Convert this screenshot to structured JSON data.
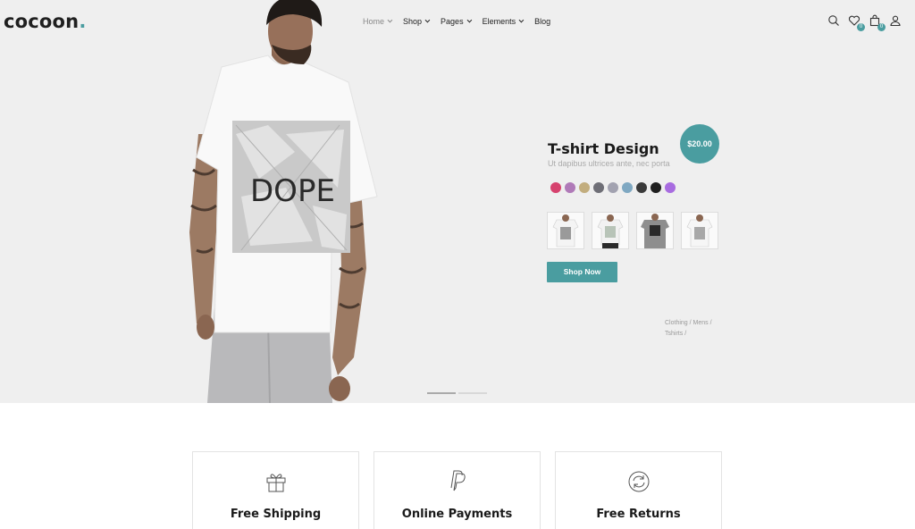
{
  "brand": {
    "logo_text": "cocoon",
    "logo_dot": ".",
    "accent": "#4a9da0"
  },
  "nav": {
    "items": [
      {
        "label": "Home",
        "has_dropdown": true
      },
      {
        "label": "Shop",
        "has_dropdown": true
      },
      {
        "label": "Pages",
        "has_dropdown": true
      },
      {
        "label": "Elements",
        "has_dropdown": true
      },
      {
        "label": "Blog",
        "has_dropdown": false
      }
    ]
  },
  "header_icons": {
    "search": {
      "icon": "search-icon"
    },
    "wishlist": {
      "icon": "heart-icon",
      "count": "0"
    },
    "cart": {
      "icon": "bag-icon",
      "count": "0"
    },
    "account": {
      "icon": "user-icon"
    }
  },
  "hero": {
    "model_shirt_text": "DOPE",
    "product": {
      "title": "T-shirt Design",
      "subtitle": "Ut dapibus ultrices ante, nec porta",
      "price": "$20.00",
      "colors": [
        "#d6426e",
        "#b07ab8",
        "#c2ad7e",
        "#6e6e76",
        "#a2a2b0",
        "#7fa8c2",
        "#3a3a3a",
        "#1f1f1f",
        "#a86ce0"
      ],
      "cta": "Shop Now",
      "breadcrumb": {
        "cat1": "Clothing",
        "cat2": "Mens",
        "cat3": "Tshirts",
        "sep": "/"
      }
    },
    "slides": {
      "count": 2,
      "active": 1
    }
  },
  "features": [
    {
      "title": "Free Shipping",
      "icon": "gift-icon"
    },
    {
      "title": "Online Payments",
      "icon": "paypal-icon"
    },
    {
      "title": "Free Returns",
      "icon": "refresh-icon"
    }
  ]
}
